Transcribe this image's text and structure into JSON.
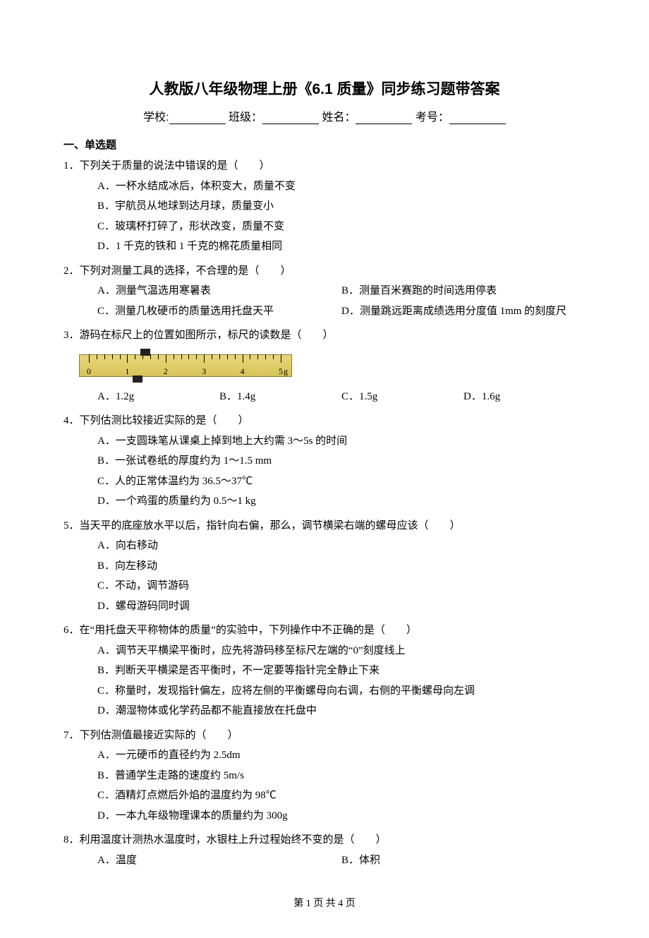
{
  "title": "人教版八年级物理上册《6.1 质量》同步练习题带答案",
  "form": {
    "school": "学校:",
    "class": "班级：",
    "name": "姓名：",
    "exam_no": "考号："
  },
  "section1": "一、单选题",
  "paren": "（　　）",
  "questions": [
    {
      "num": "1．",
      "stem": "下列关于质量的说法中错误的是",
      "layout": "vertical",
      "opts": [
        "A．一杯水结成冰后，体积变大，质量不变",
        "B．宇航员从地球到达月球，质量变小",
        "C．玻璃杯打碎了，形状改变，质量不变",
        "D．1 千克的铁和 1 千克的棉花质量相同"
      ]
    },
    {
      "num": "2．",
      "stem": "下列对测量工具的选择，不合理的是",
      "layout": "2col",
      "opts": [
        "A．测量气温选用寒暑表",
        "B．测量百米赛跑的时间选用停表",
        "C．测量几枚硬币的质量选用托盘天平",
        "D．测量跳远距离成绩选用分度值 1mm 的刻度尺"
      ]
    },
    {
      "num": "3．",
      "stem": "游码在标尺上的位置如图所示，标尺的读数是",
      "layout": "4col",
      "figure": true,
      "opts": [
        "A．1.2g",
        "B．1.4g",
        "C．1.5g",
        "D．1.6g"
      ]
    },
    {
      "num": "4．",
      "stem": "下列估测比较接近实际的是",
      "layout": "vertical",
      "opts": [
        "A．一支圆珠笔从课桌上掉到地上大约需 3～5s 的时间",
        "B．一张试卷纸的厚度约为 1～1.5 mm",
        "C．人的正常体温约为 36.5～37℃",
        "D．一个鸡蛋的质量约为 0.5～1 kg"
      ]
    },
    {
      "num": "5．",
      "stem": "当天平的底座放水平以后，指针向右偏，那么，调节横梁右端的螺母应该",
      "layout": "vertical",
      "opts": [
        "A．向右移动",
        "B．向左移动",
        "C．不动，调节游码",
        "D．螺母游码同时调"
      ]
    },
    {
      "num": "6．",
      "stem": "在“用托盘天平称物体的质量”的实验中，下列操作中不正确的是",
      "layout": "vertical",
      "opts": [
        "A．调节天平横梁平衡时，应先将游码移至标尺左端的“0”刻度线上",
        "B．判断天平横梁是否平衡时，不一定要等指针完全静止下来",
        "C．称量时，发现指针偏左，应将左侧的平衡螺母向右调，右侧的平衡螺母向左调",
        "D．潮湿物体或化学药品都不能直接放在托盘中"
      ]
    },
    {
      "num": "7．",
      "stem": "下列估测值最接近实际的",
      "layout": "vertical",
      "opts": [
        "A．一元硬币的直径约为 2.5dm",
        "B．普通学生走路的速度约 5m/s",
        "C．酒精灯点燃后外焰的温度约为 98℃",
        "D．一本九年级物理课本的质量约为 300g"
      ]
    },
    {
      "num": "8．",
      "stem": "利用温度计测热水温度时，水银柱上升过程始终不变的是",
      "layout": "2col",
      "opts": [
        "A．温度",
        "B．体积"
      ]
    }
  ],
  "ruler": {
    "labels": [
      "0",
      "1",
      "2",
      "3",
      "4",
      "5"
    ],
    "unit": "g"
  },
  "footer": "第 1 页 共 4 页"
}
